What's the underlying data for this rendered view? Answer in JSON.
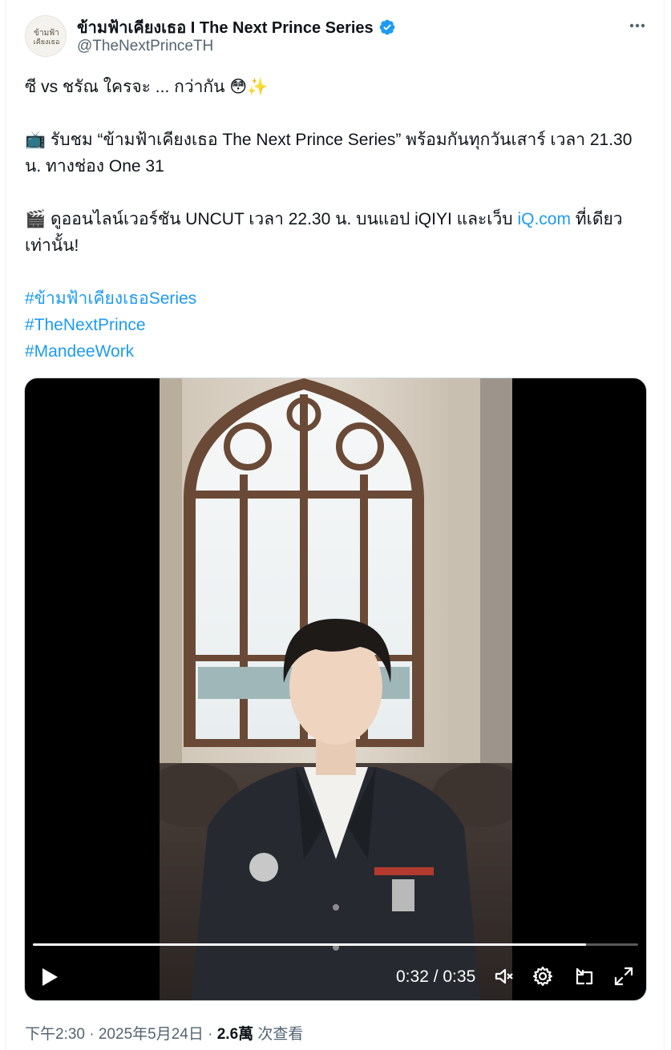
{
  "author": {
    "display_name": "ข้ามฟ้าเคียงเธอ I The Next Prince Series",
    "handle": "@TheNextPrinceTH",
    "avatar_text_line1": "ข้ามฟ้า",
    "avatar_text_line2": "เคียงเธอ",
    "verified": true,
    "verified_color": "#1d9bf0"
  },
  "tweet": {
    "line1": "ซี vs ชรัณ ใครจะ ... กว่ากัน 😳✨",
    "para2_icon": "📺",
    "para2": " รับชม “ข้ามฟ้าเคียงเธอ The Next Prince Series” พร้อมกันทุกวันเสาร์ เวลา 21.30 น. ทางช่อง One 31",
    "para3_icon": "🎬",
    "para3_before_link": " ดูออนไลน์เวอร์ชัน UNCUT เวลา 22.30 น. บนแอป iQIYI และเว็บ ",
    "para3_link": "iQ.com",
    "para3_after_link": " ที่เดียวเท่านั้น!",
    "hashtags": [
      "#ข้ามฟ้าเคียงเธอSeries",
      "#TheNextPrince",
      "#MandeeWork"
    ],
    "link_color": "#1d9bf0"
  },
  "video": {
    "current_time": "0:32",
    "duration": "0:35",
    "time_display": "0:32 / 0:35",
    "progress_fraction": 0.914
  },
  "footer": {
    "time_date": "下午2:30 · 2025年5月24日 · ",
    "views_count": "2.6萬",
    "views_label": " 次查看"
  },
  "icons": {
    "more": "more-horizontal-icon",
    "verified": "verified-badge-icon",
    "play": "play-icon",
    "volume": "volume-icon",
    "settings": "settings-gear-icon",
    "pip": "picture-in-picture-icon",
    "fullscreen": "fullscreen-icon"
  }
}
